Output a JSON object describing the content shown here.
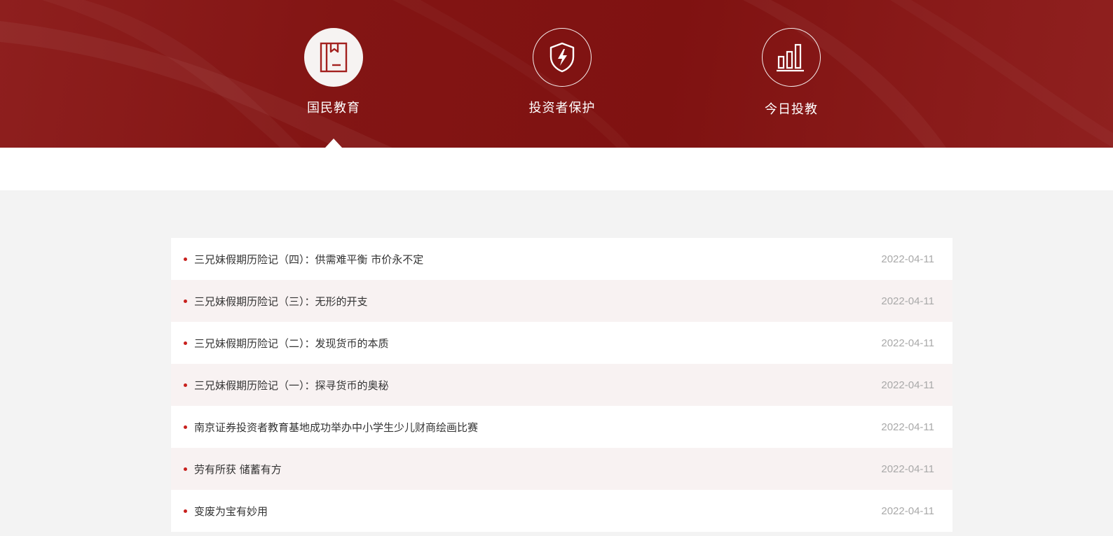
{
  "colors": {
    "banner": "#811312",
    "bullet": "#c8201d",
    "date": "#a9a9a9",
    "alt_row": "#f8f2f2"
  },
  "tabs": [
    {
      "label": "国民教育",
      "icon": "book-icon",
      "active": true
    },
    {
      "label": "投资者保护",
      "icon": "shield-lightning-icon",
      "active": false
    },
    {
      "label": "今日投教",
      "icon": "bar-chart-icon",
      "active": false
    }
  ],
  "news": [
    {
      "title": "三兄妹假期历险记（四）：供需难平衡 市价永不定",
      "date": "2022-04-11"
    },
    {
      "title": "三兄妹假期历险记（三）：无形的开支",
      "date": "2022-04-11"
    },
    {
      "title": "三兄妹假期历险记（二）：发现货币的本质",
      "date": "2022-04-11"
    },
    {
      "title": "三兄妹假期历险记（一）：探寻货币的奥秘",
      "date": "2022-04-11"
    },
    {
      "title": "南京证券投资者教育基地成功举办中小学生少儿财商绘画比赛",
      "date": "2022-04-11"
    },
    {
      "title": "劳有所获 储蓄有方",
      "date": "2022-04-11"
    },
    {
      "title": "变废为宝有妙用",
      "date": "2022-04-11"
    }
  ]
}
